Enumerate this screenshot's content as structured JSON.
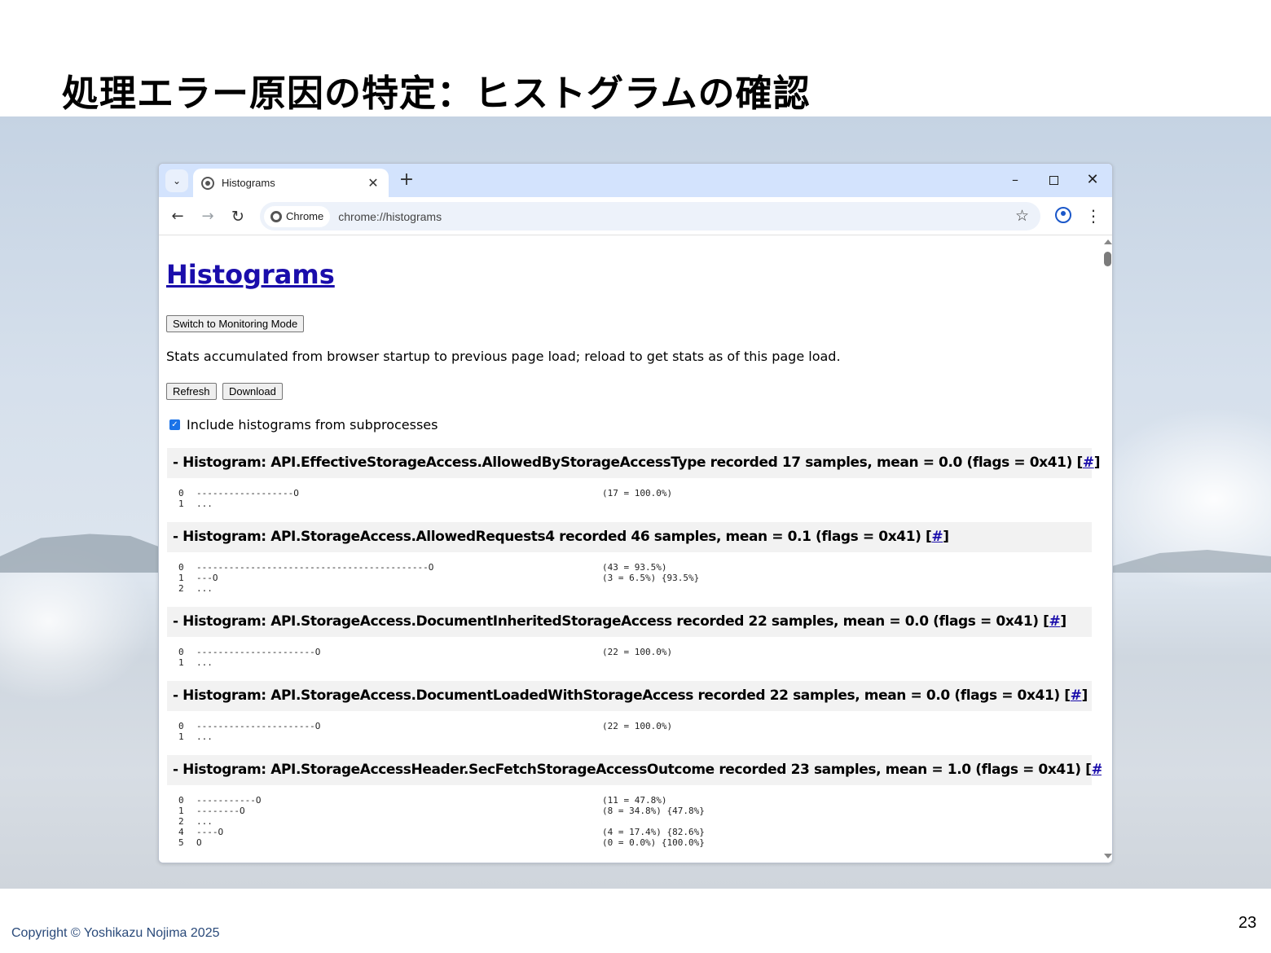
{
  "slide": {
    "title": "処理エラー原因の特定：ヒストグラムの確認",
    "copyright": "Copyright © Yoshikazu Nojima 2025",
    "page_number": "23"
  },
  "browser": {
    "tab_title": "Histograms",
    "chip_label": "Chrome",
    "url": "chrome://histograms"
  },
  "page": {
    "heading": "Histograms",
    "monitor_button": "Switch to Monitoring Mode",
    "stats_text": "Stats accumulated from browser startup to previous page load; reload to get stats as of this page load.",
    "refresh_button": "Refresh",
    "download_button": "Download",
    "include_label": "Include histograms from subprocesses",
    "include_checked": true
  },
  "histograms": [
    {
      "header": "- Histogram: API.EffectiveStorageAccess.AllowedByStorageAccessType recorded 17 samples, mean = 0.0 (flags = 0x41) [",
      "link": "#",
      "close": "]",
      "rows": [
        {
          "idx": "0",
          "bar": "------------------O",
          "stat": "(17 = 100.0%)"
        },
        {
          "idx": "1",
          "bar": "...",
          "stat": ""
        }
      ]
    },
    {
      "header": "- Histogram: API.StorageAccess.AllowedRequests4 recorded 46 samples, mean = 0.1 (flags = 0x41) [",
      "link": "#",
      "close": "]",
      "rows": [
        {
          "idx": "0",
          "bar": "-------------------------------------------O",
          "stat": "(43 = 93.5%)"
        },
        {
          "idx": "1",
          "bar": "---O",
          "stat": "(3 = 6.5%) {93.5%}"
        },
        {
          "idx": "2",
          "bar": "...",
          "stat": ""
        }
      ]
    },
    {
      "header": "- Histogram: API.StorageAccess.DocumentInheritedStorageAccess recorded 22 samples, mean = 0.0 (flags = 0x41) [",
      "link": "#",
      "close": "]",
      "rows": [
        {
          "idx": "0",
          "bar": "----------------------O",
          "stat": "(22 = 100.0%)"
        },
        {
          "idx": "1",
          "bar": "...",
          "stat": ""
        }
      ]
    },
    {
      "header": "- Histogram: API.StorageAccess.DocumentLoadedWithStorageAccess recorded 22 samples, mean = 0.0 (flags = 0x41) [",
      "link": "#",
      "close": "]",
      "rows": [
        {
          "idx": "0",
          "bar": "----------------------O",
          "stat": "(22 = 100.0%)"
        },
        {
          "idx": "1",
          "bar": "...",
          "stat": ""
        }
      ]
    },
    {
      "header": "- Histogram: API.StorageAccessHeader.SecFetchStorageAccessOutcome recorded 23 samples, mean = 1.0 (flags = 0x41) [",
      "link": "#",
      "close": "]",
      "rows": [
        {
          "idx": "0",
          "bar": "-----------O",
          "stat": "(11 = 47.8%)"
        },
        {
          "idx": "1",
          "bar": "--------O",
          "stat": "(8 = 34.8%) {47.8%}"
        },
        {
          "idx": "2",
          "bar": "...",
          "stat": ""
        },
        {
          "idx": "4",
          "bar": "----O",
          "stat": "(4 = 17.4%) {82.6%}"
        },
        {
          "idx": "5",
          "bar": "O",
          "stat": "(0 = 0.0%) {100.0%}"
        }
      ]
    }
  ]
}
